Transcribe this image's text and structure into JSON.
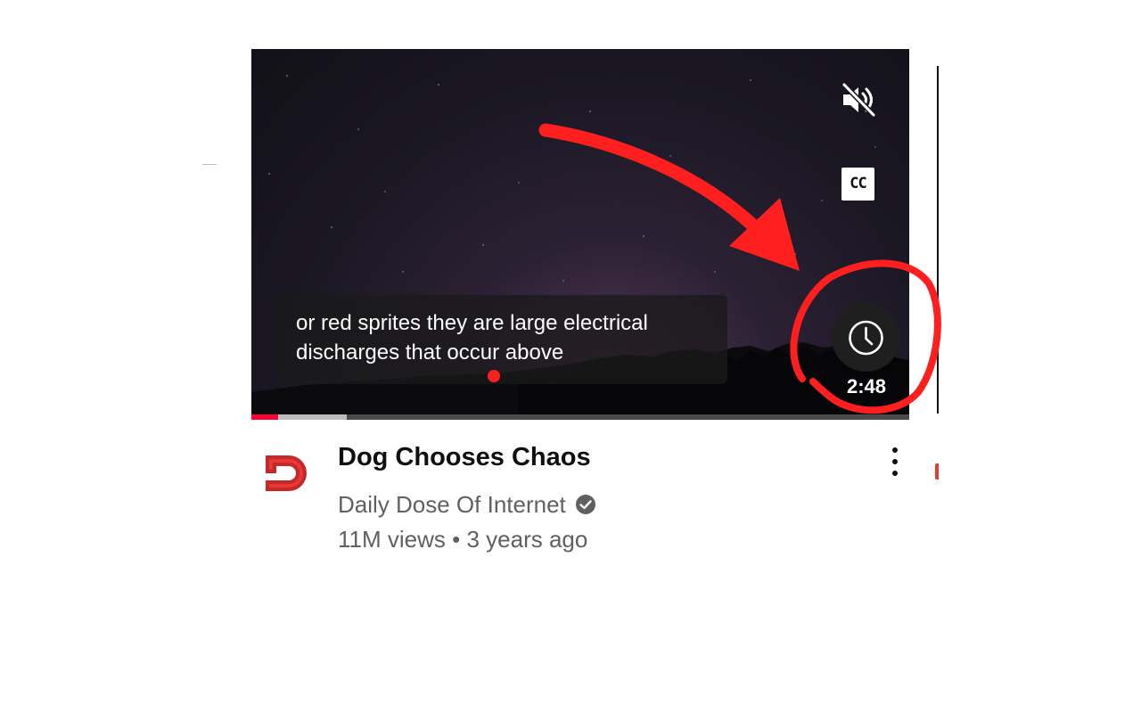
{
  "video": {
    "caption_line1": "or red sprites they are large electrical",
    "caption_line2": "discharges that occur above",
    "duration": "2:48",
    "cc_label": "CC",
    "progress_played": 0.04,
    "progress_buffered": 0.145,
    "mute_icon": "volume-muted-icon",
    "watch_later_icon": "clock-icon"
  },
  "details": {
    "title": "Dog Chooses Chaos",
    "channel": "Daily Dose Of Internet",
    "verified": true,
    "views": "11M views",
    "separator": "•",
    "age": "3 years ago"
  },
  "colors": {
    "annotation": "#ff1f1f",
    "progress_played": "#ff0033",
    "avatar": "#c62828"
  }
}
